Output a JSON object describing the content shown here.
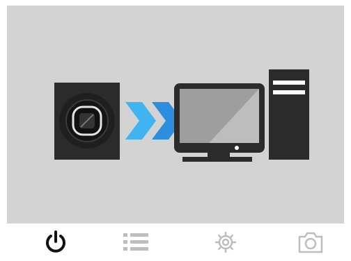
{
  "screen": {
    "scene": "usb-camera-to-computer-connection",
    "icons": [
      "camera-module-icon",
      "chevron-arrows-icon",
      "desktop-computer-icon"
    ]
  },
  "navbar": {
    "items": [
      {
        "name": "power",
        "icon": "power-icon",
        "active": true
      },
      {
        "name": "menu",
        "icon": "list-icon",
        "active": false
      },
      {
        "name": "settings",
        "icon": "gear-icon",
        "active": false
      },
      {
        "name": "camera",
        "icon": "camera-icon",
        "active": false
      }
    ]
  },
  "colors": {
    "background": "#d3d3d3",
    "device_dark": "#2b2b2b",
    "arrow_light": "#3fb4f0",
    "arrow_mid": "#2d8ee0",
    "arrow_dark": "#1565c0",
    "active_icon": "#111111",
    "inactive_icon": "#bdbdbd"
  }
}
